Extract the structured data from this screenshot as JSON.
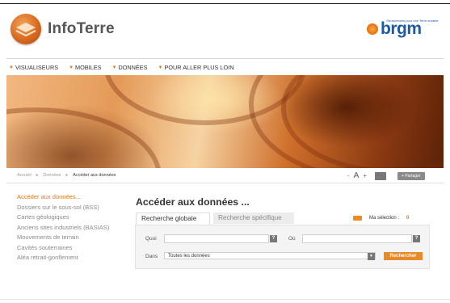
{
  "brand": {
    "name": "InfoTerre",
    "partner": "brgm",
    "partner_tagline": "Géosciences pour une Terre durable"
  },
  "nav": {
    "items": [
      "VISUALISEURS",
      "MOBILES",
      "DONNÉES",
      "POUR ALLER PLUS LOIN"
    ]
  },
  "breadcrumb": {
    "items": [
      "Accueil",
      "Données",
      "Accéder aux données"
    ]
  },
  "tools": {
    "decrease": "-",
    "font": "A",
    "increase": "+",
    "share": "+ Partager"
  },
  "sidebar": {
    "items": [
      "Accéder aux données...",
      "Dossiers sur le sous-sol (BSS)",
      "Cartes géologiques",
      "Anciens sites industriels (BASIAS)",
      "Mouvements de terrain",
      "Cavités souterraines",
      "Aléa retrait-gonflement"
    ]
  },
  "main": {
    "title": "Accéder aux données ...",
    "tabs": [
      "Recherche globale",
      "Recherche spécifique"
    ],
    "selection_label": "Ma sélection :",
    "selection_count": "0"
  },
  "search": {
    "quoi_label": "Quoi",
    "ou_label": "Où",
    "dans_label": "Dans",
    "help": "?",
    "dans_value": "Toutes les données",
    "submit": "Rechercher"
  },
  "colors": {
    "accent": "#e98a2a",
    "brgm_blue": "#1c5aa8"
  }
}
